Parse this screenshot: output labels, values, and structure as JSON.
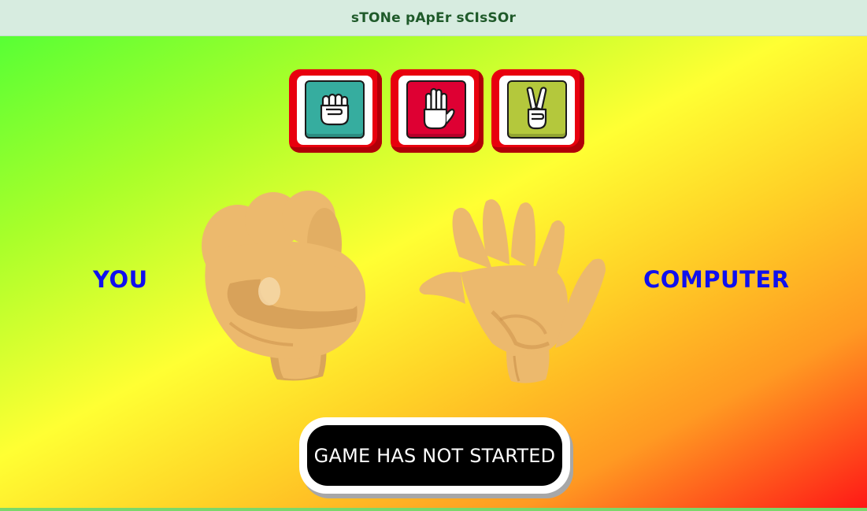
{
  "app": {
    "title": "sTONe pApEr sCIsSOr"
  },
  "choices": [
    {
      "name": "stone",
      "icon": "fist-icon",
      "color": "#36ad9f"
    },
    {
      "name": "paper",
      "icon": "open-hand-icon",
      "color": "#de0033"
    },
    {
      "name": "scissor",
      "icon": "victory-hand-icon",
      "color": "#b4c83c"
    }
  ],
  "player": {
    "label": "YOU",
    "hand": "fist-icon"
  },
  "computer": {
    "label": "COMPUTER",
    "hand": "open-hand-icon"
  },
  "status": {
    "text": "GAME HAS NOT STARTED"
  },
  "colors": {
    "button_frame": "#e8000e",
    "label_text": "#1010ee",
    "skin": "#ecb96d",
    "status_bg": "#000000"
  }
}
